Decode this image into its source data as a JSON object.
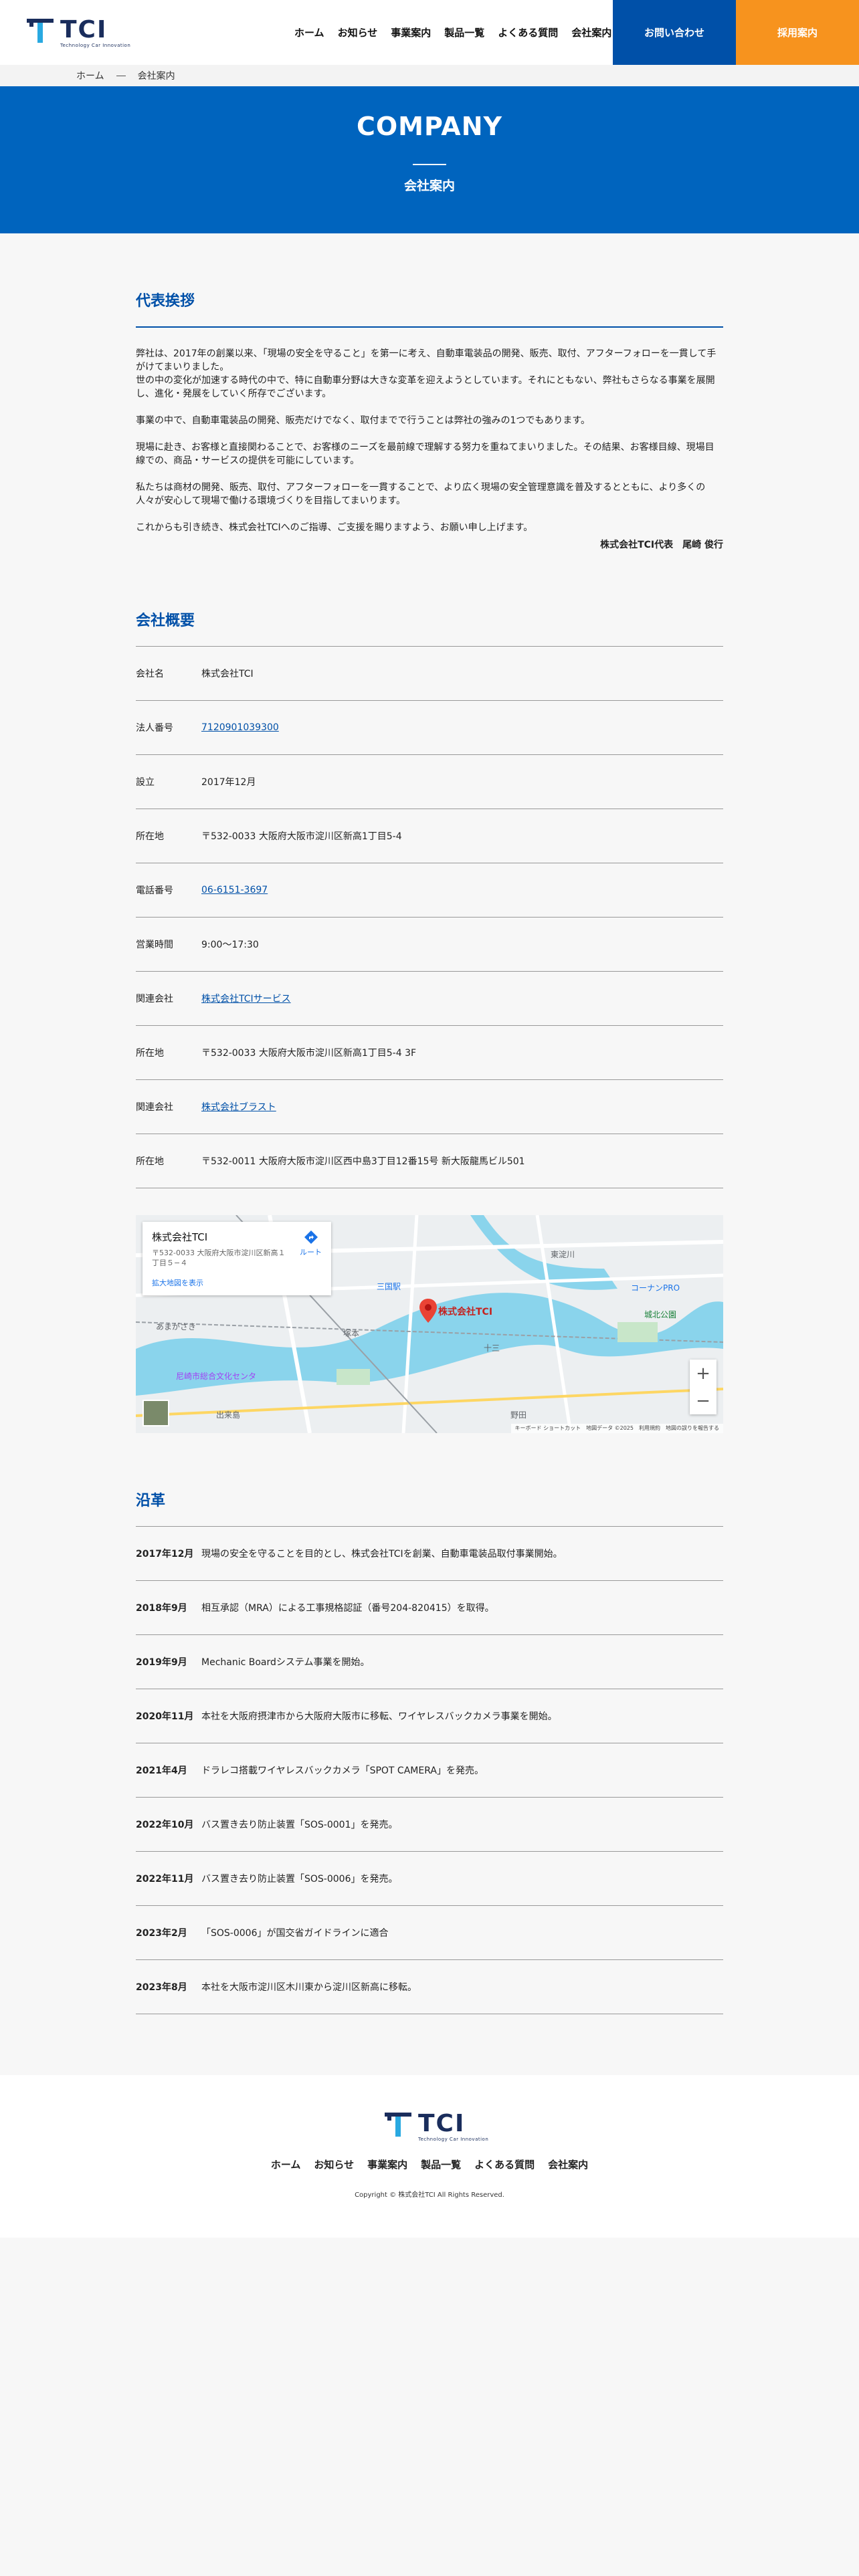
{
  "brand": {
    "logo_text": "TCI",
    "logo_sub": "Technology Car Innovation",
    "colors": {
      "primary": "#0050a8",
      "hero": "#0064be",
      "accent": "#f7931e"
    }
  },
  "header": {
    "nav": [
      "ホーム",
      "お知らせ",
      "事業案内",
      "製品一覧",
      "よくある質問",
      "会社案内"
    ],
    "contact_label": "お問い合わせ",
    "recruit_label": "採用案内"
  },
  "breadcrumb": {
    "home": "ホーム",
    "current": "会社案内"
  },
  "hero": {
    "en": "COMPANY",
    "ja": "会社案内"
  },
  "greeting": {
    "title": "代表挨拶",
    "paragraphs": [
      "弊社は、2017年の創業以来、「現場の安全を守ること」を第一に考え、自動車電装品の開発、販売、取付、アフターフォローを一貫して手がけてまいりました。\n世の中の変化が加速する時代の中で、特に自動車分野は大きな変革を迎えようとしています。それにともない、弊社もさらなる事業を展開し、進化・発展をしていく所存でございます。",
      "事業の中で、自動車電装品の開発、販売だけでなく、取付までで行うことは弊社の強みの1つでもあります。",
      "現場に赴き、お客様と直接関わることで、お客様のニーズを最前線で理解する努力を重ねてまいりました。その結果、お客様目線、現場目線での、商品・サービスの提供を可能にしています。",
      "私たちは商材の開発、販売、取付、アフターフォローを一貫することで、より広く現場の安全管理意識を普及するとともに、より多くの人々が安心して現場で働ける環境づくりを目指してまいります。",
      "これからも引き続き、株式会社TCIへのご指導、ご支援を賜りますよう、お願い申し上げます。"
    ],
    "signature": "株式会社TCI代表　尾崎 俊行"
  },
  "overview": {
    "title": "会社概要",
    "rows": [
      {
        "label": "会社名",
        "value": "株式会社TCI",
        "link": false
      },
      {
        "label": "法人番号",
        "value": "7120901039300",
        "link": true
      },
      {
        "label": "設立",
        "value": "2017年12月",
        "link": false
      },
      {
        "label": "所在地",
        "value": "〒532-0033 大阪府大阪市淀川区新高1丁目5-4",
        "link": false
      },
      {
        "label": "電話番号",
        "value": "06-6151-3697",
        "link": true
      },
      {
        "label": "営業時間",
        "value": "9:00〜17:30",
        "link": false
      },
      {
        "label": "関連会社",
        "value": "株式会社TCIサービス",
        "link": true
      },
      {
        "label": "所在地",
        "value": "〒532-0033 大阪府大阪市淀川区新高1丁目5-4 3F",
        "link": false
      },
      {
        "label": "関連会社",
        "value": "株式会社ブラスト",
        "link": true
      },
      {
        "label": "所在地",
        "value": "〒532-0011 大阪府大阪市淀川区西中島3丁目12番15号 新大阪龍馬ビル501",
        "link": false
      }
    ]
  },
  "map": {
    "card_name": "株式会社TCI",
    "card_addr": "〒532-0033 大阪府大阪市淀川区新高１丁目５−４",
    "enlarge": "拡大地図を表示",
    "route": "ルート",
    "pin_label": "株式会社TCI",
    "places": [
      "あまがさき",
      "尼崎市総合文化センタ",
      "三国駅",
      "塚本",
      "十三",
      "城北公園",
      "コーナンPRO",
      "東淀川",
      "出来島",
      "野田"
    ],
    "footer": "キーボード ショートカット　地図データ ©2025　利用規約　地図の誤りを報告する"
  },
  "history": {
    "title": "沿革",
    "rows": [
      {
        "year": "2017年12月",
        "text": "現場の安全を守ることを目的とし、株式会社TCIを創業、自動車電装品取付事業開始。"
      },
      {
        "year": "2018年9月",
        "text": "相互承認（MRA）による工事規格認証（番号204-820415）を取得。"
      },
      {
        "year": "2019年9月",
        "text": "Mechanic Boardシステム事業を開始。"
      },
      {
        "year": "2020年11月",
        "text": "本社を大阪府摂津市から大阪府大阪市に移転、ワイヤレスバックカメラ事業を開始。"
      },
      {
        "year": "2021年4月",
        "text": "ドラレコ搭載ワイヤレスバックカメラ「SPOT CAMERA」を発売。"
      },
      {
        "year": "2022年10月",
        "text": "バス置き去り防止装置「SOS-0001」を発売。"
      },
      {
        "year": "2022年11月",
        "text": "バス置き去り防止装置「SOS-0006」を発売。"
      },
      {
        "year": "2023年2月",
        "text": "「SOS-0006」が国交省ガイドラインに適合"
      },
      {
        "year": "2023年8月",
        "text": "本社を大阪市淀川区木川東から淀川区新高に移転。"
      }
    ]
  },
  "footer": {
    "nav": [
      "ホーム",
      "お知らせ",
      "事業案内",
      "製品一覧",
      "よくある質問",
      "会社案内"
    ],
    "copyright": "Copyright © 株式会社TCI All Rights Reserved."
  }
}
